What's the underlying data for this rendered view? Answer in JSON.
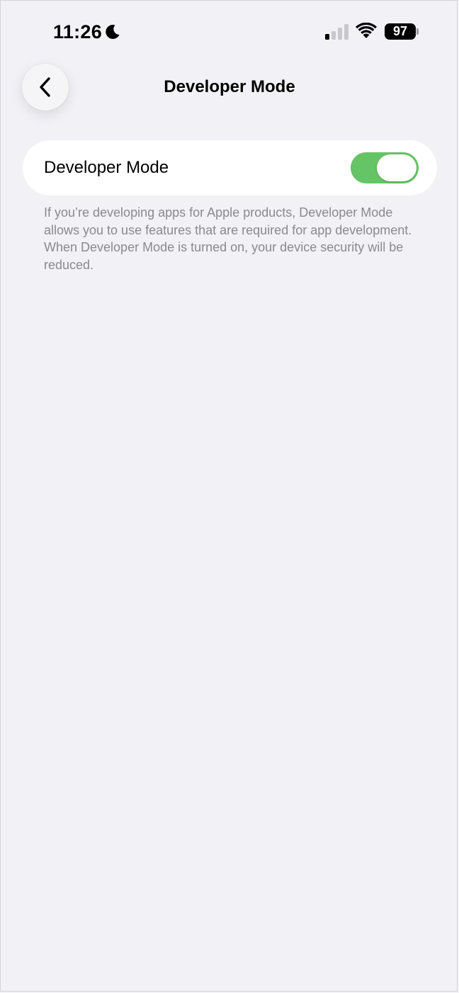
{
  "status_bar": {
    "time": "11:26",
    "battery_level": "97",
    "focus_icon": "moon-icon",
    "signal_icon": "cellular-signal-icon",
    "wifi_icon": "wifi-icon"
  },
  "nav": {
    "back_icon": "chevron-left-icon",
    "title": "Developer Mode"
  },
  "settings": {
    "developer_mode": {
      "label": "Developer Mode",
      "enabled": true
    },
    "footer": "If you’re developing apps for Apple products, Developer Mode allows you to use features that are required for app development. When Developer Mode is turned on, your device security will be reduced."
  },
  "colors": {
    "background": "#f2f1f6",
    "card": "#ffffff",
    "toggle_on": "#65c466",
    "footer_text": "#8a8a8e"
  }
}
